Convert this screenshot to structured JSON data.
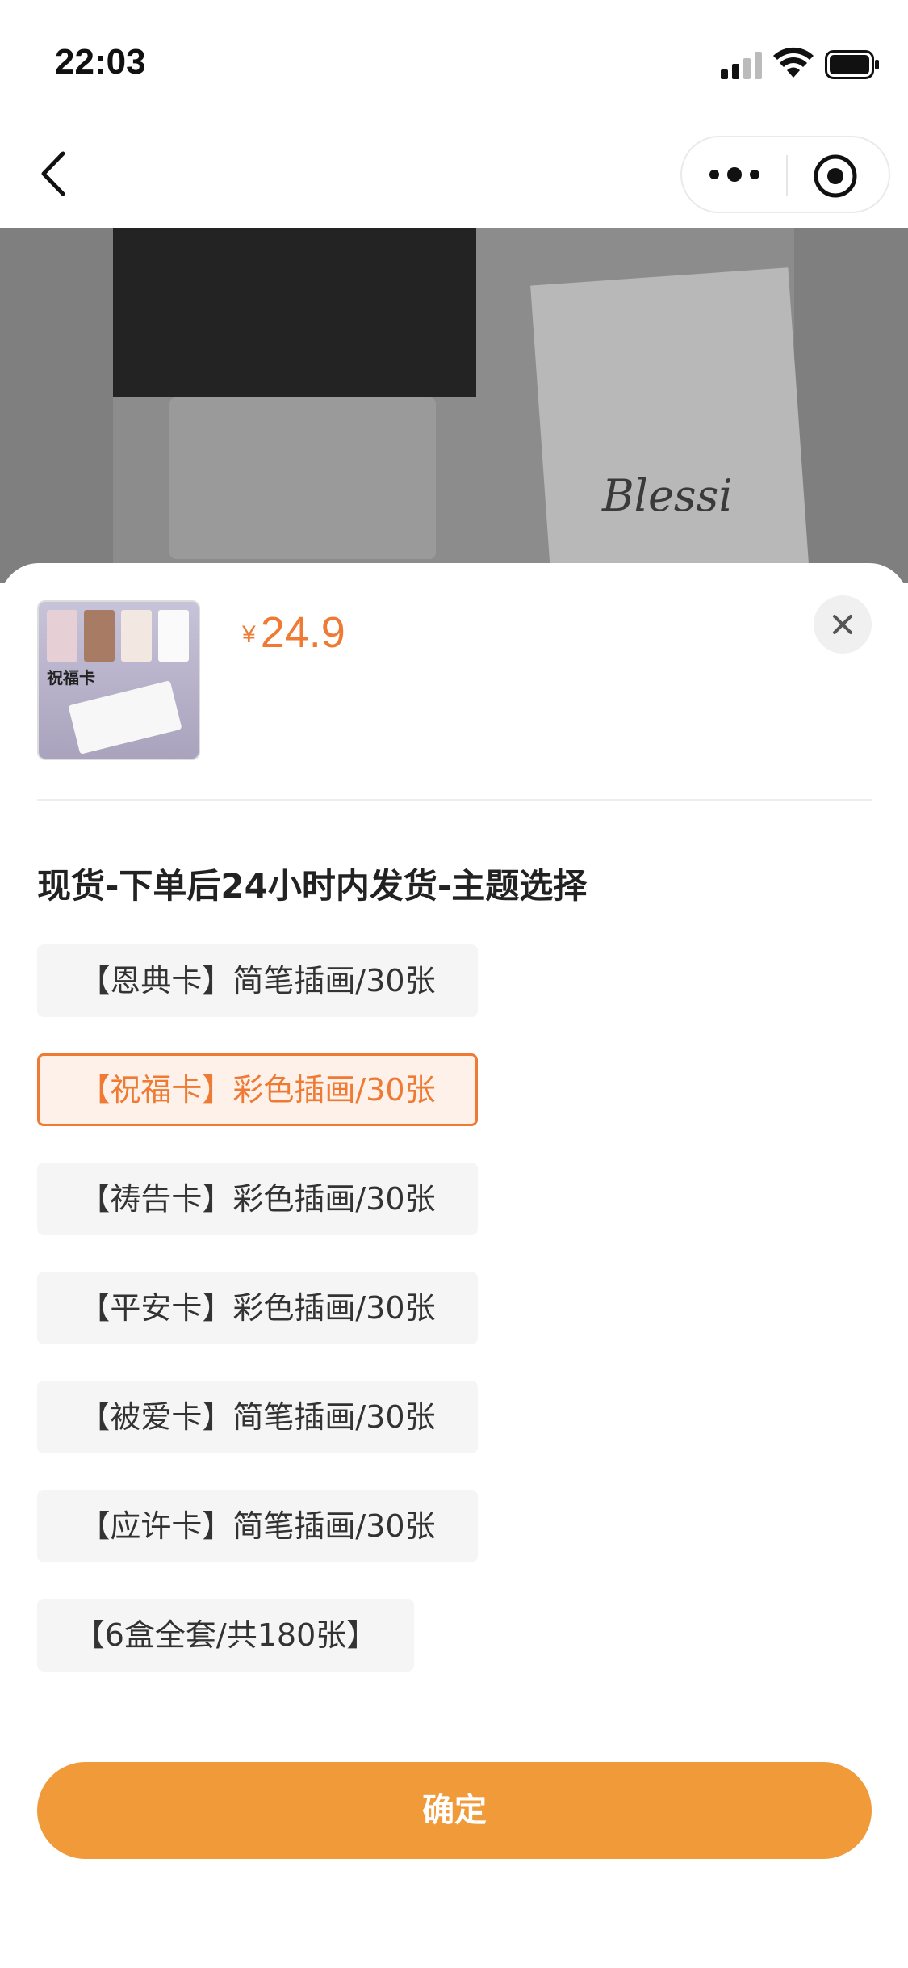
{
  "status_bar": {
    "time": "22:03"
  },
  "product": {
    "currency": "¥",
    "price": "24.9",
    "thumbnail_title": "祝福卡",
    "hero_text": "Blessi"
  },
  "spec": {
    "title": "现货-下单后24小时内发货-主题选择",
    "options": [
      {
        "label": "【恩典卡】简笔插画/30张",
        "selected": false
      },
      {
        "label": "【祝福卡】彩色插画/30张",
        "selected": true
      },
      {
        "label": "【祷告卡】彩色插画/30张",
        "selected": false
      },
      {
        "label": "【平安卡】彩色插画/30张",
        "selected": false
      },
      {
        "label": "【被爱卡】简笔插画/30张",
        "selected": false
      },
      {
        "label": "【应许卡】简笔插画/30张",
        "selected": false
      },
      {
        "label": "【6盒全套/共180张】",
        "selected": false
      }
    ]
  },
  "confirm_label": "确定",
  "colors": {
    "accent": "#ee7a33",
    "button": "#f09a3a"
  }
}
